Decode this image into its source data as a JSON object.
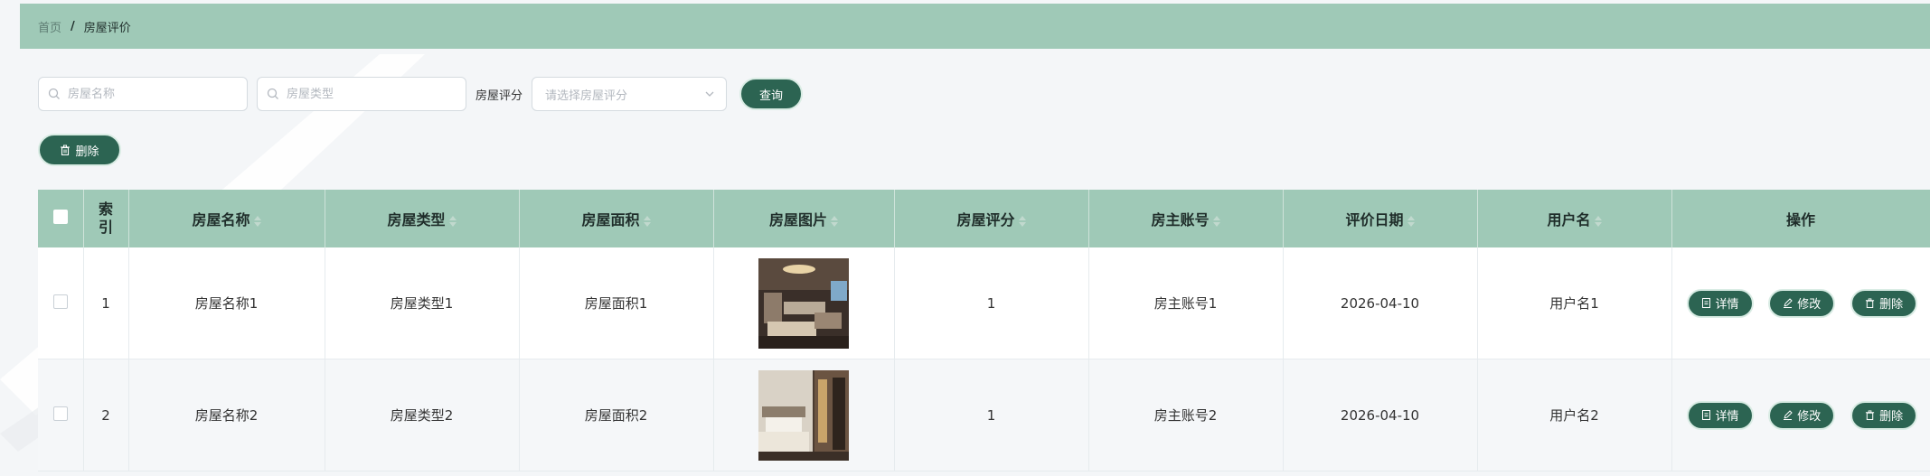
{
  "breadcrumb": {
    "home": "首页",
    "separator": "/",
    "current": "房屋评价"
  },
  "search": {
    "name_placeholder": "房屋名称",
    "type_placeholder": "房屋类型",
    "rating_label": "房屋评分",
    "rating_placeholder": "请选择房屋评分",
    "query_label": "查询"
  },
  "toolbar": {
    "delete_label": "删除"
  },
  "table": {
    "headers": {
      "index": "索引",
      "name": "房屋名称",
      "type": "房屋类型",
      "area": "房屋面积",
      "image": "房屋图片",
      "rating": "房屋评分",
      "owner": "房主账号",
      "date": "评价日期",
      "user": "用户名",
      "actions": "操作"
    },
    "rows": [
      {
        "index": "1",
        "name": "房屋名称1",
        "type": "房屋类型1",
        "area": "房屋面积1",
        "rating": "1",
        "owner": "房主账号1",
        "date": "2026-04-10",
        "user": "用户名1"
      },
      {
        "index": "2",
        "name": "房屋名称2",
        "type": "房屋类型2",
        "area": "房屋面积2",
        "rating": "1",
        "owner": "房主账号2",
        "date": "2026-04-10",
        "user": "用户名2"
      }
    ],
    "actions": {
      "detail": "详情",
      "edit": "修改",
      "delete": "删除"
    }
  },
  "colors": {
    "header_green": "#9fc9b7",
    "button_dark": "#2c6452"
  },
  "icons": [
    "search-icon",
    "chevron-down-icon",
    "trash-icon",
    "document-icon",
    "pencil-icon"
  ]
}
